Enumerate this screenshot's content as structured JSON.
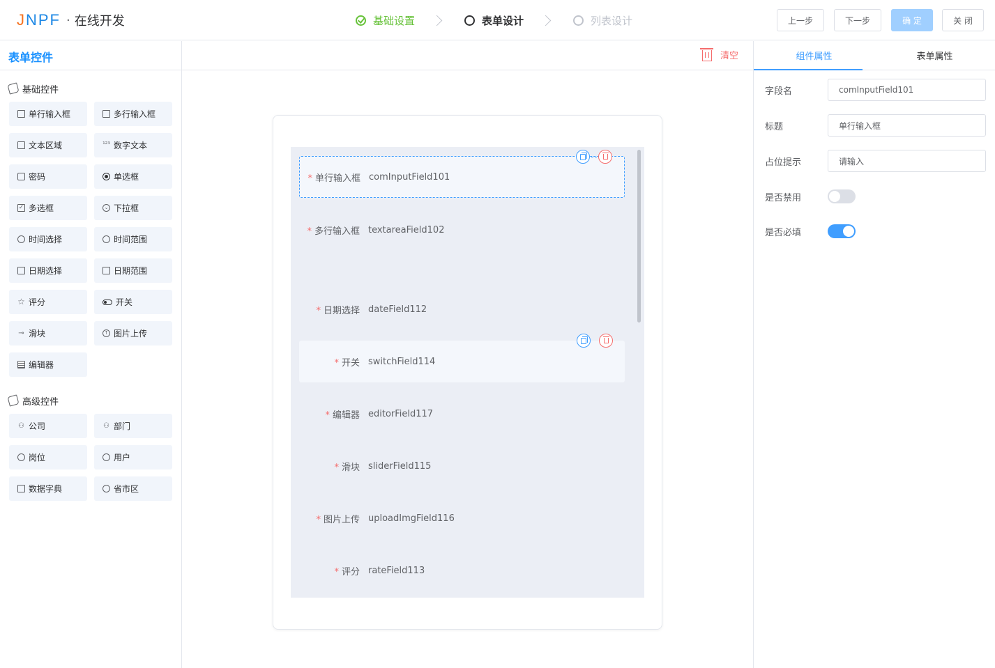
{
  "header": {
    "logo": "JNPF",
    "subtitle": "在线开发",
    "steps": [
      {
        "label": "基础设置",
        "state": "done"
      },
      {
        "label": "表单设计",
        "state": "active"
      },
      {
        "label": "列表设计",
        "state": "todo"
      }
    ],
    "buttons": {
      "prev": "上一步",
      "next": "下一步",
      "confirm": "确 定",
      "close": "关 闭"
    }
  },
  "left": {
    "title": "表单控件",
    "basic_title": "基础控件",
    "basic": [
      {
        "label": "单行输入框",
        "icon": "input-icon"
      },
      {
        "label": "多行输入框",
        "icon": "textarea-icon"
      },
      {
        "label": "文本区域",
        "icon": "text-area-icon"
      },
      {
        "label": "数字文本",
        "icon": "number-icon"
      },
      {
        "label": "密码",
        "icon": "lock-icon"
      },
      {
        "label": "单选框",
        "icon": "radio-icon"
      },
      {
        "label": "多选框",
        "icon": "checkbox-icon"
      },
      {
        "label": "下拉框",
        "icon": "select-icon"
      },
      {
        "label": "时间选择",
        "icon": "clock-icon"
      },
      {
        "label": "时间范围",
        "icon": "clock-range-icon"
      },
      {
        "label": "日期选择",
        "icon": "calendar-icon"
      },
      {
        "label": "日期范围",
        "icon": "calendar-range-icon"
      },
      {
        "label": "评分",
        "icon": "star-icon"
      },
      {
        "label": "开关",
        "icon": "switch-icon"
      },
      {
        "label": "滑块",
        "icon": "slider-icon"
      },
      {
        "label": "图片上传",
        "icon": "upload-icon"
      },
      {
        "label": "编辑器",
        "icon": "editor-icon"
      }
    ],
    "advanced_title": "高级控件",
    "advanced": [
      {
        "label": "公司",
        "icon": "company-icon"
      },
      {
        "label": "部门",
        "icon": "department-icon"
      },
      {
        "label": "岗位",
        "icon": "position-icon"
      },
      {
        "label": "用户",
        "icon": "user-icon"
      },
      {
        "label": "数据字典",
        "icon": "dictionary-icon"
      },
      {
        "label": "省市区",
        "icon": "region-icon"
      }
    ]
  },
  "center": {
    "clear_label": "清空",
    "fields": [
      {
        "label": "单行输入框",
        "value": "comInputField101",
        "required": true,
        "state": "selected"
      },
      {
        "label": "多行输入框",
        "value": "textareaField102",
        "required": true,
        "state": "normal"
      },
      {
        "label": "日期选择",
        "value": "dateField112",
        "required": true,
        "state": "normal"
      },
      {
        "label": "开关",
        "value": "switchField114",
        "required": true,
        "state": "hovered"
      },
      {
        "label": "编辑器",
        "value": "editorField117",
        "required": true,
        "state": "normal"
      },
      {
        "label": "滑块",
        "value": "sliderField115",
        "required": true,
        "state": "normal"
      },
      {
        "label": "图片上传",
        "value": "uploadImgField116",
        "required": true,
        "state": "normal"
      },
      {
        "label": "评分",
        "value": "rateField113",
        "required": true,
        "state": "normal"
      }
    ]
  },
  "right": {
    "tabs": [
      "组件属性",
      "表单属性"
    ],
    "props": {
      "field_name_label": "字段名",
      "field_name_value": "comInputField101",
      "title_label": "标题",
      "title_value": "单行输入框",
      "placeholder_label": "占位提示",
      "placeholder_value": "请输入",
      "disabled_label": "是否禁用",
      "disabled": false,
      "required_label": "是否必填",
      "required": true
    }
  },
  "colors": {
    "primary": "#409eff",
    "success": "#67c23a",
    "danger": "#f56c6c",
    "title_blue": "#1890ff"
  }
}
